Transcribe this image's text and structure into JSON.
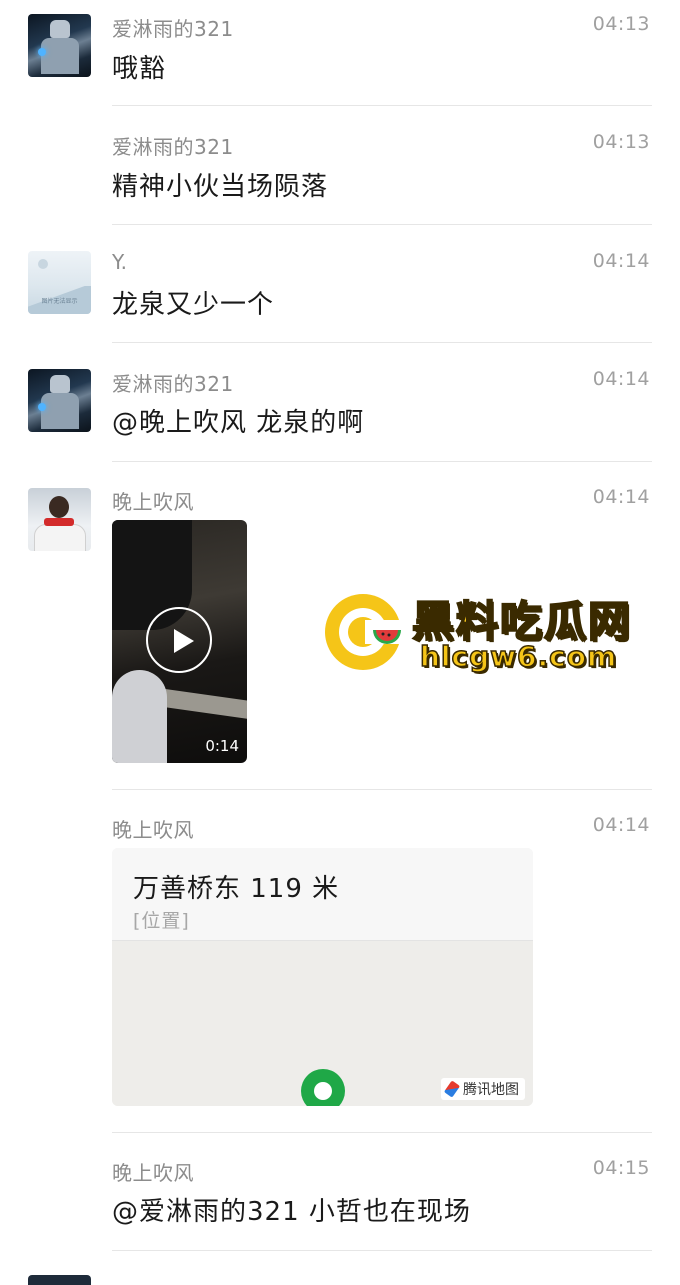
{
  "messages": [
    {
      "sender": "爱淋雨的321",
      "time": "04:13",
      "text": "哦豁"
    },
    {
      "sender": "爱淋雨的321",
      "time": "04:13",
      "text": "精神小伙当场陨落"
    },
    {
      "sender": "Y.",
      "time": "04:14",
      "text": "龙泉又少一个"
    },
    {
      "sender": "爱淋雨的321",
      "time": "04:14",
      "text": "@晚上吹风 龙泉的啊"
    },
    {
      "sender": "晚上吹风",
      "time": "04:14",
      "video_duration": "0:14"
    },
    {
      "sender": "晚上吹风",
      "time": "04:14",
      "location": {
        "name": "万善桥东 119 米",
        "type": "[位置]",
        "provider": "腾讯地图"
      }
    },
    {
      "sender": "晚上吹风",
      "time": "04:15",
      "text": "@爱淋雨的321 小哲也在现场"
    }
  ],
  "avatars": {
    "landscape_caption": "图片无法显示"
  },
  "watermark": {
    "title": "黑料吃瓜网",
    "url": "hlcgw6.com",
    "color": "#f5c518"
  },
  "icons": {
    "play": "play-icon",
    "pin": "map-pin-icon",
    "compass": "tencent-map-logo-icon"
  }
}
